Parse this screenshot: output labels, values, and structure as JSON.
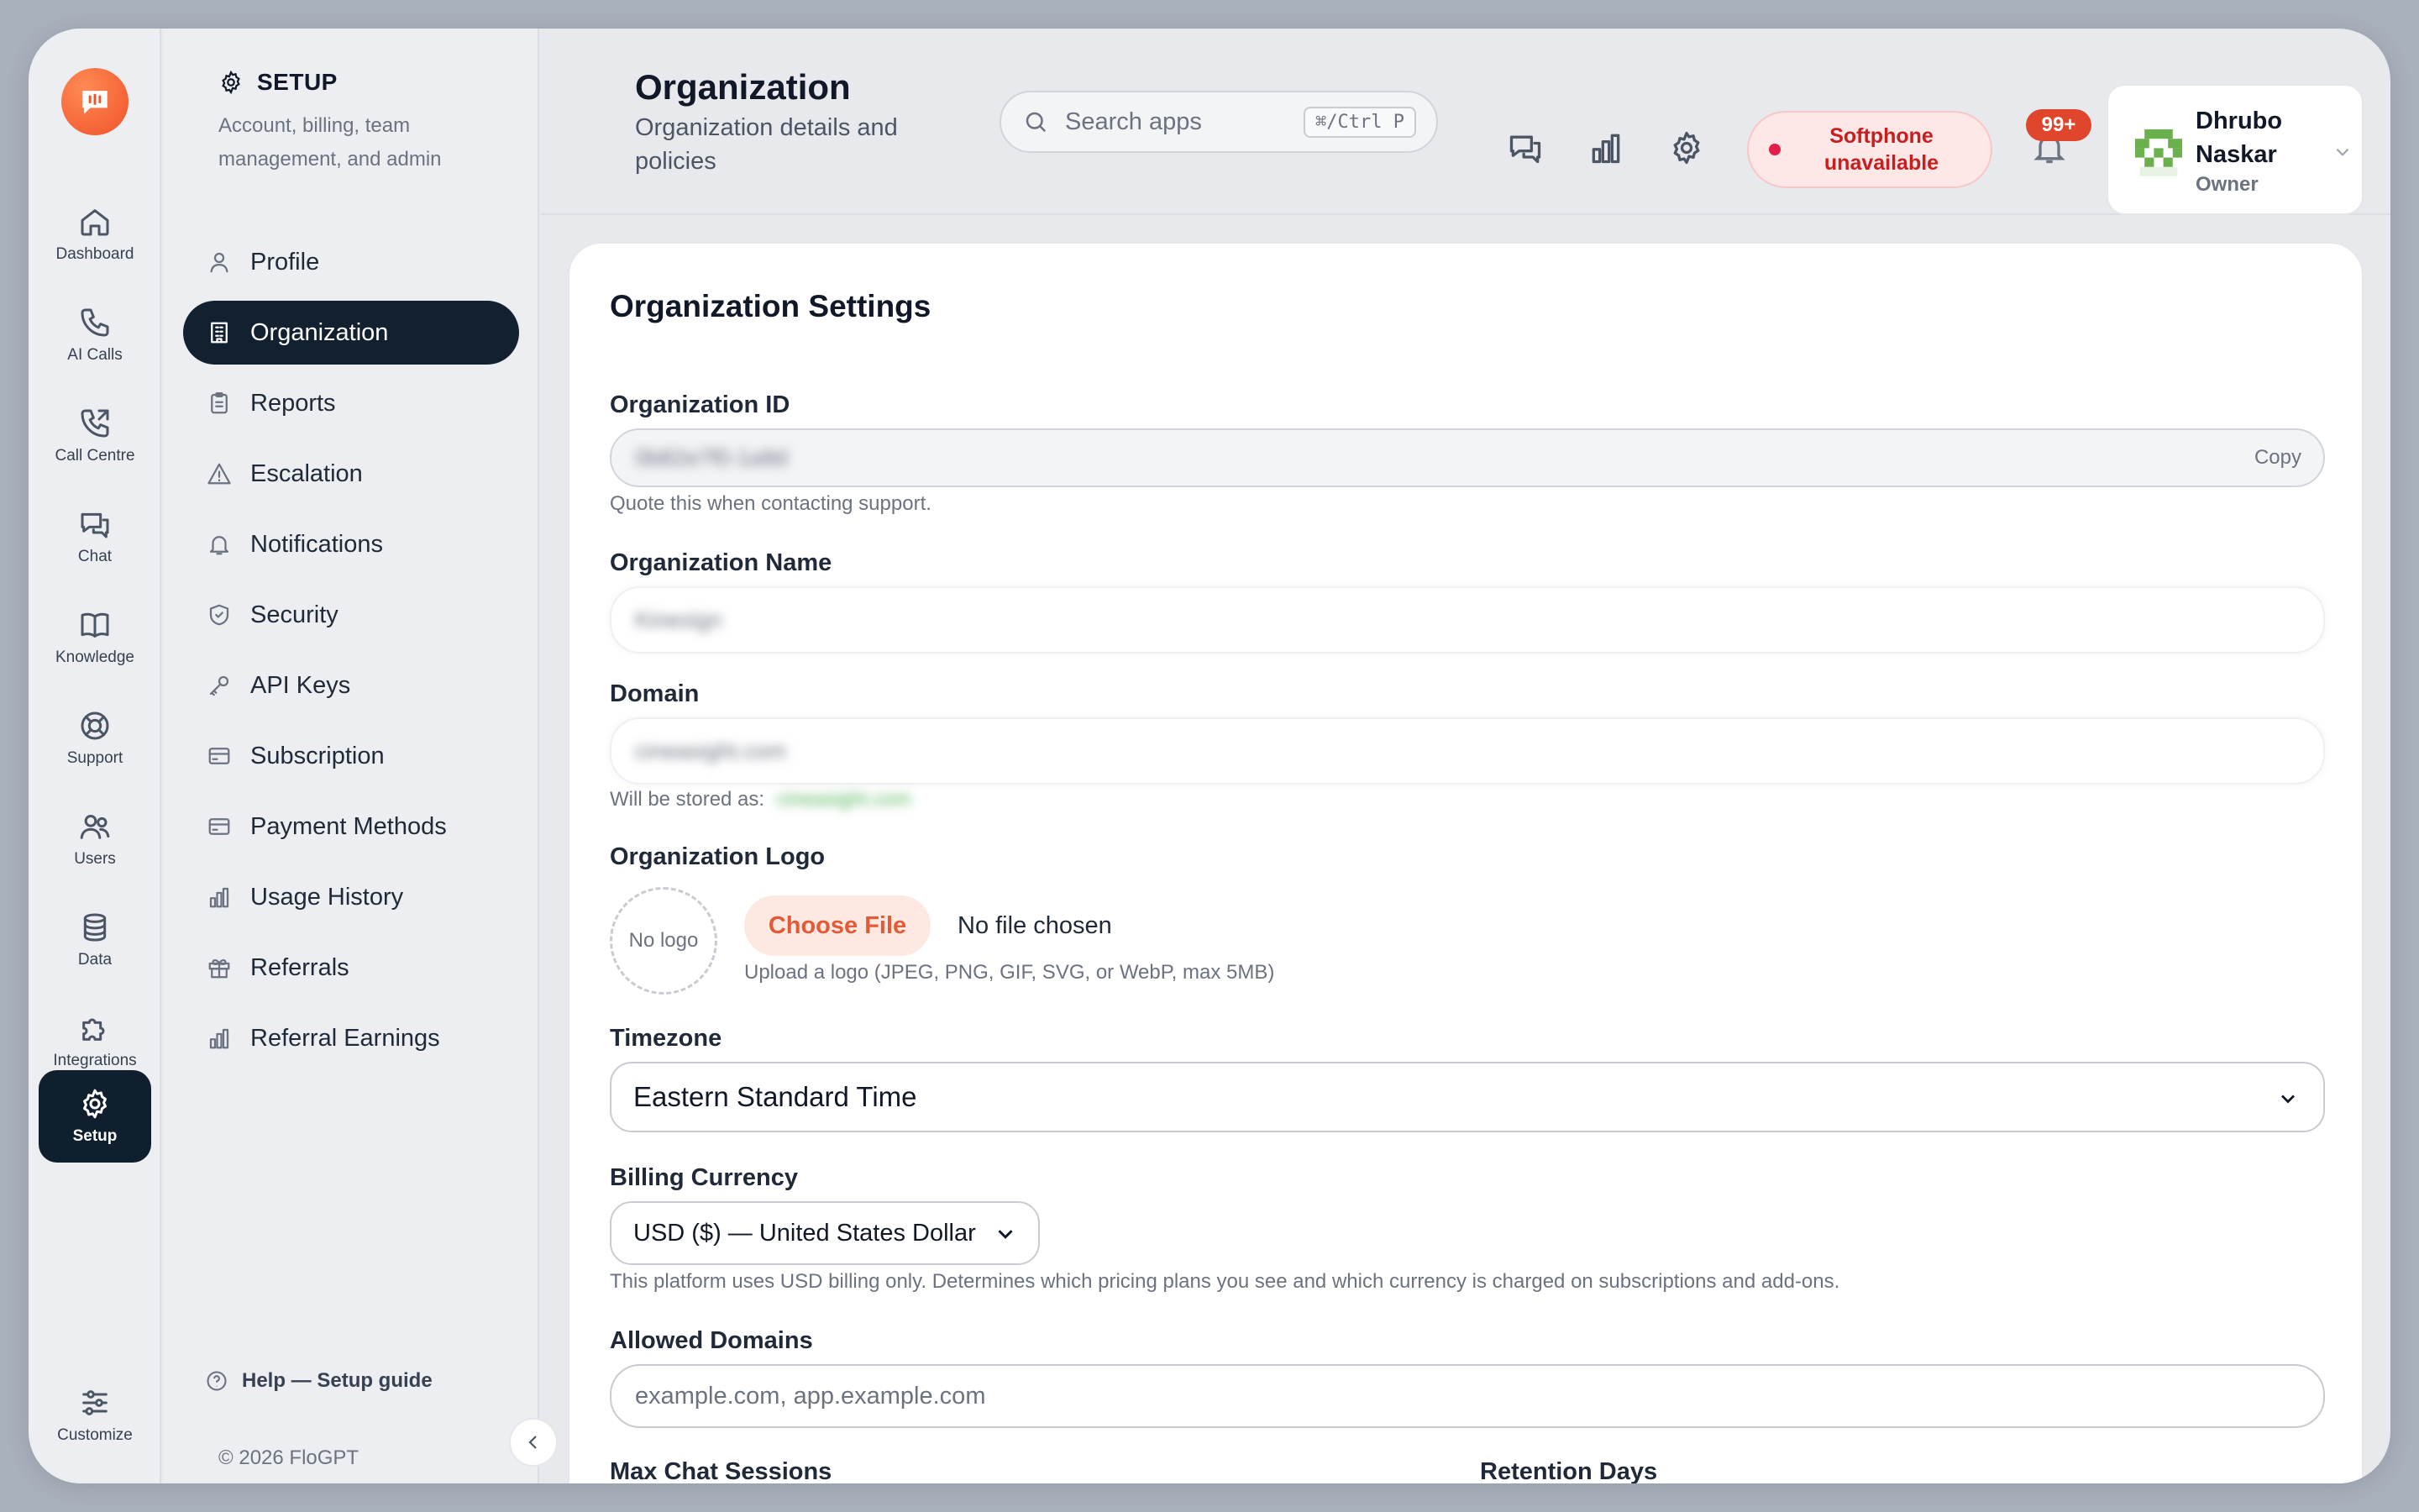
{
  "rail": {
    "items": [
      {
        "label": "Dashboard",
        "icon": "home-icon"
      },
      {
        "label": "AI Calls",
        "icon": "phone-icon"
      },
      {
        "label": "Call Centre",
        "icon": "phone-forward-icon"
      },
      {
        "label": "Chat",
        "icon": "chat-icon"
      },
      {
        "label": "Knowledge",
        "icon": "book-icon"
      },
      {
        "label": "Support",
        "icon": "lifebuoy-icon"
      },
      {
        "label": "Users",
        "icon": "users-icon"
      },
      {
        "label": "Data",
        "icon": "database-icon"
      },
      {
        "label": "Integrations",
        "icon": "puzzle-icon"
      },
      {
        "label": "Setup",
        "icon": "gear-icon",
        "active": true
      }
    ],
    "customize": "Customize"
  },
  "sidebar": {
    "title": "SETUP",
    "subtitle": "Account, billing, team management, and admin",
    "items": [
      {
        "label": "Profile",
        "icon": "user-icon"
      },
      {
        "label": "Organization",
        "icon": "building-icon",
        "active": true
      },
      {
        "label": "Reports",
        "icon": "clipboard-icon"
      },
      {
        "label": "Escalation",
        "icon": "warning-icon"
      },
      {
        "label": "Notifications",
        "icon": "bell-icon"
      },
      {
        "label": "Security",
        "icon": "shield-icon"
      },
      {
        "label": "API Keys",
        "icon": "key-icon"
      },
      {
        "label": "Subscription",
        "icon": "card-icon"
      },
      {
        "label": "Payment Methods",
        "icon": "card-icon"
      },
      {
        "label": "Usage History",
        "icon": "bar-chart-icon"
      },
      {
        "label": "Referrals",
        "icon": "gift-icon"
      },
      {
        "label": "Referral Earnings",
        "icon": "bar-chart-icon"
      }
    ],
    "help": "Help — Setup guide",
    "copyright": "© 2026 FloGPT"
  },
  "header": {
    "title": "Organization",
    "subtitle": "Organization details and policies",
    "search_placeholder": "Search apps",
    "search_shortcut": "⌘/Ctrl P",
    "softphone_status": "Softphone unavailable",
    "notifications_count": "99+",
    "user_name": "Dhrubo Naskar",
    "user_role": "Owner"
  },
  "form": {
    "title": "Organization Settings",
    "org_id_label": "Organization ID",
    "org_id_value": "0b82e7f0-1a9d",
    "copy_label": "Copy",
    "org_id_help": "Quote this when contacting support.",
    "org_name_label": "Organization Name",
    "org_name_value": "Kinesign",
    "domain_label": "Domain",
    "domain_value": "cineasight.com",
    "domain_help_prefix": "Will be stored as:",
    "domain_stored": "cineasight.com",
    "logo_label": "Organization Logo",
    "no_logo": "No logo",
    "choose_file": "Choose File",
    "no_file": "No file chosen",
    "logo_help": "Upload a logo (JPEG, PNG, GIF, SVG, or WebP, max 5MB)",
    "timezone_label": "Timezone",
    "timezone_value": "Eastern Standard Time",
    "currency_label": "Billing Currency",
    "currency_value": "USD ($) — United States Dollar",
    "currency_help": "This platform uses USD billing only. Determines which pricing plans you see and which currency is charged on subscriptions and add-ons.",
    "allowed_domains_label": "Allowed Domains",
    "allowed_domains_placeholder": "example.com, app.example.com",
    "max_chat_label": "Max Chat Sessions",
    "retention_label": "Retention Days"
  },
  "colors": {
    "accent": "#e35a36",
    "active_nav": "#12202f",
    "danger": "#c81e1e"
  }
}
